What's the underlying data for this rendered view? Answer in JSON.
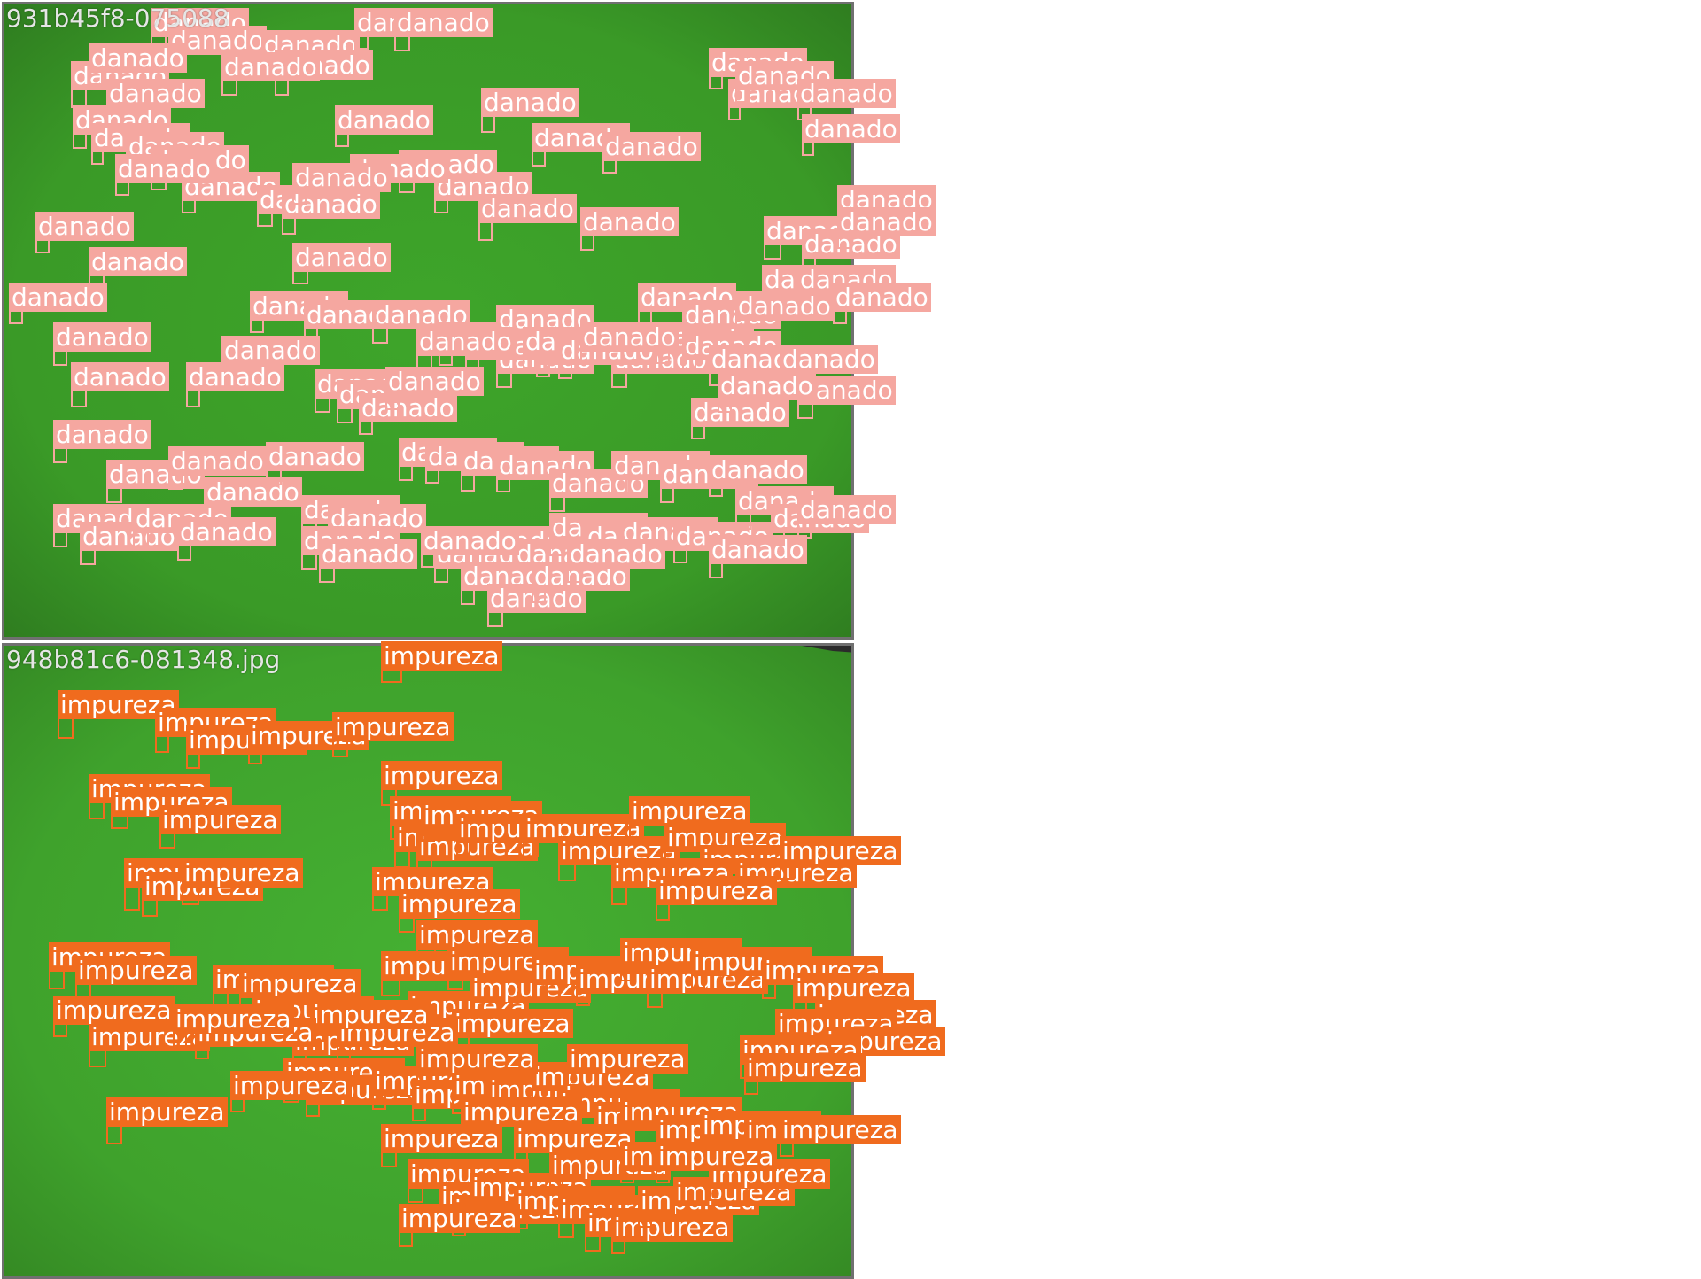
{
  "panels": [
    {
      "filename": "931b45f8-075088",
      "class_label": "danado",
      "color": "#f5a7a0",
      "background": "#45a02e"
    },
    {
      "filename": "948b81c6-081348.jpg",
      "class_label": "impureza",
      "color": "#f06b1e",
      "background": "#45a02e"
    }
  ]
}
